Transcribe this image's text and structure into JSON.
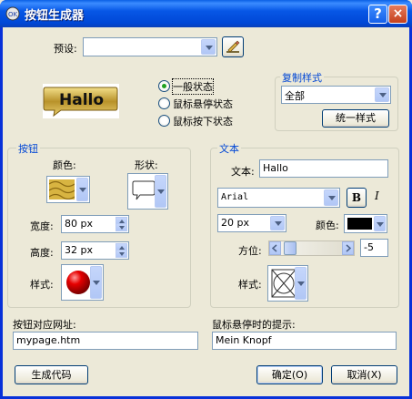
{
  "window": {
    "title": "按钮生成器",
    "help_label": "?",
    "close_label": "×"
  },
  "preset": {
    "label": "预设:",
    "value": ""
  },
  "preview": {
    "text": "Hallo"
  },
  "states": {
    "items": [
      {
        "label": "一般状态",
        "selected": true
      },
      {
        "label": "鼠标悬停状态",
        "selected": false
      },
      {
        "label": "鼠标按下状态",
        "selected": false
      }
    ]
  },
  "copy_style": {
    "title": "复制样式",
    "select_value": "全部",
    "unify_button": "统一样式"
  },
  "button_group": {
    "title": "按钮",
    "color_label": "颜色:",
    "shape_label": "形状:",
    "width_label": "宽度:",
    "width_value": "80 px",
    "height_label": "高度:",
    "height_value": "32 px",
    "style_label": "样式:"
  },
  "text_group": {
    "title": "文本",
    "text_label": "文本:",
    "text_value": "Hallo",
    "font_value": "Arial",
    "bold_label": "B",
    "italic_label": "I",
    "size_value": "20 px",
    "color_label": "颜色:",
    "position_label": "方位:",
    "position_value": "-5",
    "style_label": "样式:"
  },
  "url": {
    "label": "按钮对应网址:",
    "value": "mypage.htm"
  },
  "tooltip": {
    "label": "鼠标悬停时的提示:",
    "value": "Mein Knopf"
  },
  "footer": {
    "generate_button": "生成代码",
    "ok_button": "确定(O)",
    "cancel_button": "取消(X)"
  },
  "colors": {
    "titlebar": "#0054e3",
    "group_title": "#0046d5",
    "text_color": "#000000",
    "button_style_color": "#e60000"
  }
}
